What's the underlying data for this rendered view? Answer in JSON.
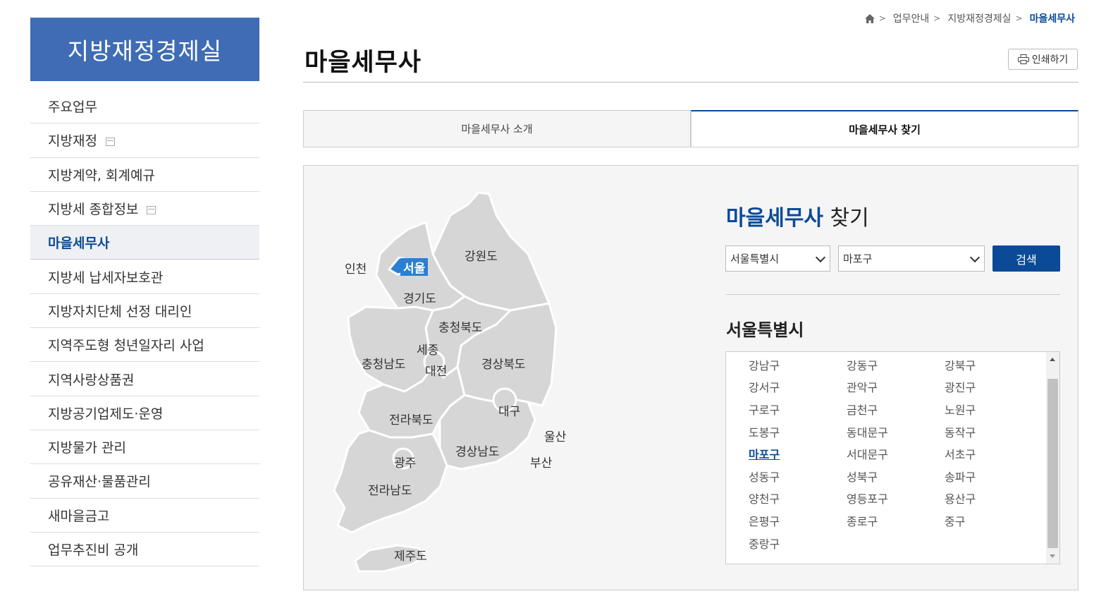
{
  "sidebar": {
    "title": "지방재정경제실",
    "items": [
      {
        "label": "주요업무"
      },
      {
        "label": "지방재정"
      },
      {
        "label": "지방계약, 회계예규"
      },
      {
        "label": "지방세 종합정보"
      },
      {
        "label": "마을세무사"
      },
      {
        "label": "지방세 납세자보호관"
      },
      {
        "label": "지방자치단체 선정 대리인"
      },
      {
        "label": "지역주도형 청년일자리 사업"
      },
      {
        "label": "지역사랑상품권"
      },
      {
        "label": "지방공기업제도·운영"
      },
      {
        "label": "지방물가 관리"
      },
      {
        "label": "공유재산·물품관리"
      },
      {
        "label": "새마을금고"
      },
      {
        "label": "업무추진비 공개"
      }
    ]
  },
  "breadcrumb": {
    "items": [
      "업무안내",
      "지방재정경제실",
      "마을세무사"
    ]
  },
  "page": {
    "title": "마을세무사",
    "print_label": "인쇄하기"
  },
  "tabs": [
    {
      "label": "마을세무사 소개"
    },
    {
      "label": "마을세무사 찾기"
    }
  ],
  "map": {
    "regions": {
      "incheon": "인천",
      "seoul": "서울",
      "gangwon": "강원도",
      "gyeonggi": "경기도",
      "chungbuk": "충청북도",
      "sejong": "세종",
      "chungnam": "충청남도",
      "daejeon": "대전",
      "gyeongbuk": "경상북도",
      "daegu": "대구",
      "jeonbuk": "전라북도",
      "ulsan": "울산",
      "gyeongnam": "경상남도",
      "gwangju": "광주",
      "busan": "부산",
      "jeonnam": "전라남도",
      "jeju": "제주도"
    },
    "selected_region": "서울"
  },
  "finder": {
    "title_highlight": "마을세무사",
    "title_rest": "찾기",
    "city_select": "서울특별시",
    "district_select": "마포구",
    "search_label": "검색",
    "city_heading": "서울특별시",
    "districts": [
      "강남구",
      "강동구",
      "강북구",
      "강서구",
      "관악구",
      "광진구",
      "구로구",
      "금천구",
      "노원구",
      "도봉구",
      "동대문구",
      "동작구",
      "마포구",
      "서대문구",
      "서초구",
      "성동구",
      "성북구",
      "송파구",
      "양천구",
      "영등포구",
      "용산구",
      "은평구",
      "종로구",
      "중구",
      "중랑구"
    ],
    "selected_district": "마포구"
  },
  "colors": {
    "brand": "#3f6cb4",
    "accent": "#0b4a97",
    "map_fill": "#d6d6d6",
    "map_selected": "#2a7fd4"
  }
}
